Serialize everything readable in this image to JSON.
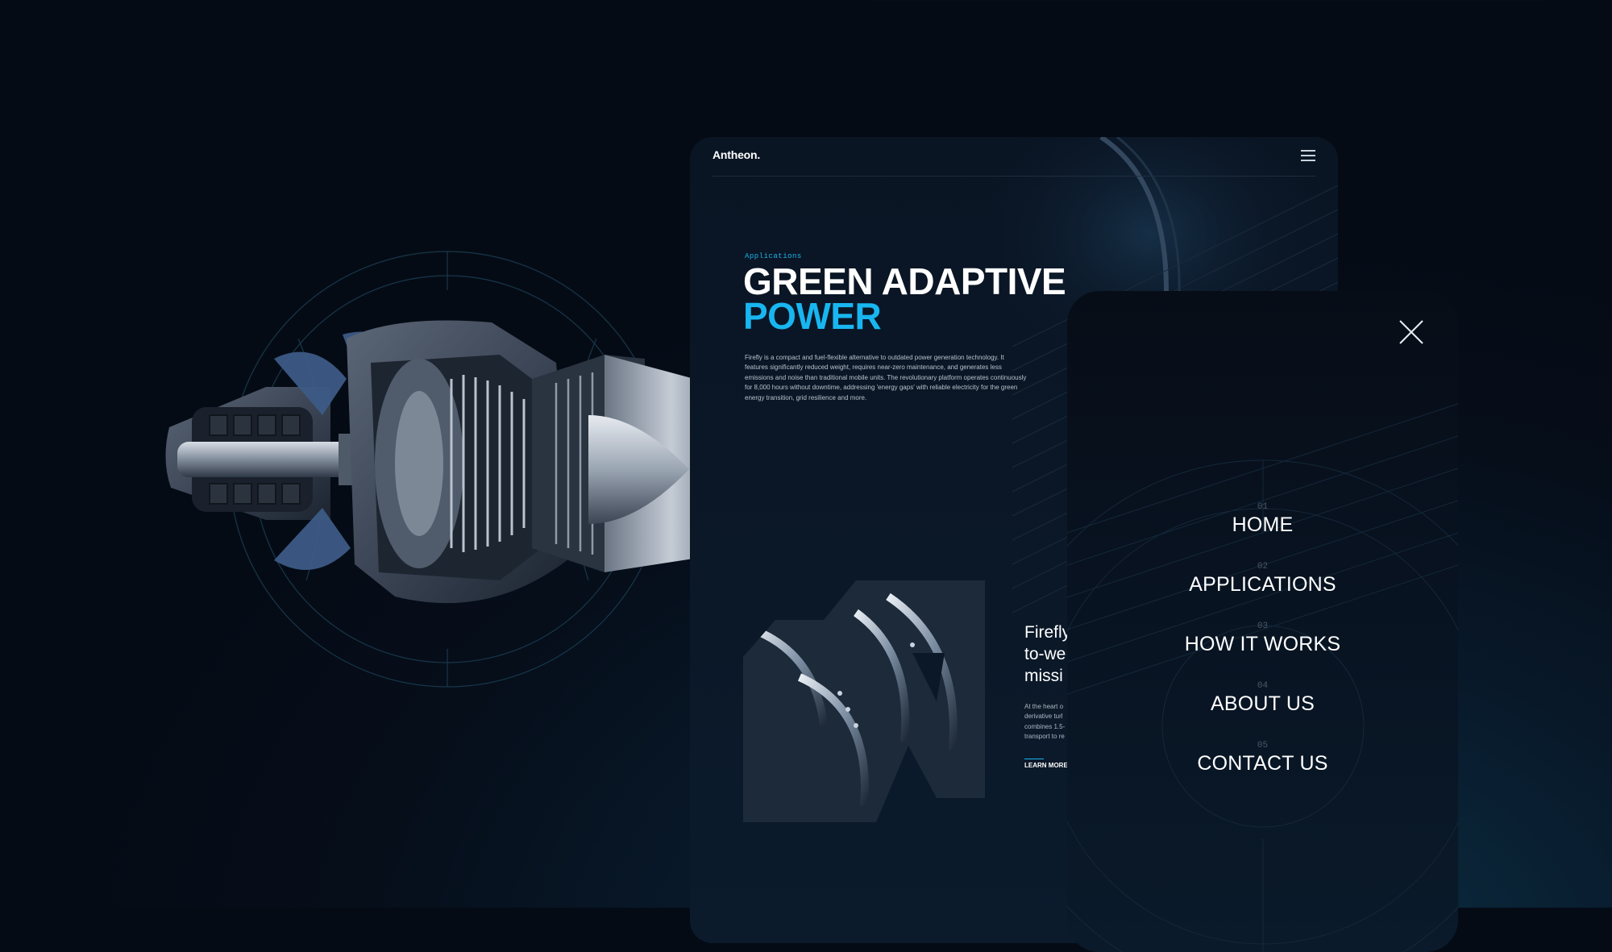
{
  "desktop": {
    "brand": "Antheon.",
    "menu_icon": "hamburger-icon",
    "eyebrow": "Applications",
    "title_line1": "GREEN ADAPTIVE",
    "title_line2": "POWER",
    "body": "Firefly is a compact and fuel-flexible alternative to outdated power generation technology. It features significantly reduced weight, requires near-zero maintenance, and generates less emissions and noise than traditional mobile units. The revolutionary platform operates continuously for 8,000 hours without downtime, addressing 'energy gaps' with reliable electricity for the green energy transition, grid resilience and more.",
    "feature_title_lines": [
      "Firefly",
      "to-we",
      "missi"
    ],
    "feature_body_lines": [
      "At the heart o",
      "derivative turl",
      "combines 1.5-",
      "transport to re"
    ],
    "learn_more": "LEARN MORE"
  },
  "mobile_menu": {
    "close_icon": "close-icon",
    "items": [
      {
        "num": "01",
        "label": "HOME"
      },
      {
        "num": "02",
        "label": "APPLICATIONS"
      },
      {
        "num": "03",
        "label": "HOW IT WORKS"
      },
      {
        "num": "04",
        "label": "ABOUT US"
      },
      {
        "num": "05",
        "label": "CONTACT US"
      }
    ]
  },
  "colors": {
    "accent": "#18b6f0",
    "background": "#060e1a",
    "card": "#0a1524"
  },
  "illustration": "turbine-engine-cutaway"
}
